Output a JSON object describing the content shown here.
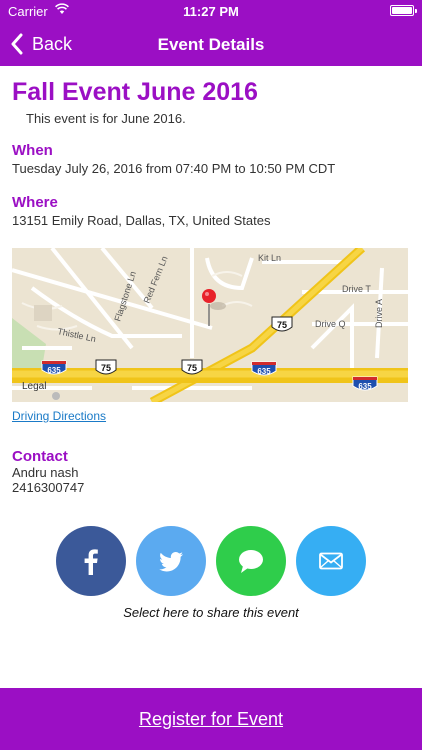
{
  "status": {
    "carrier": "Carrier",
    "time": "11:27 PM"
  },
  "nav": {
    "back_label": "Back",
    "title": "Event Details"
  },
  "event": {
    "title": "Fall Event June 2016",
    "description": "This event is for June 2016."
  },
  "when": {
    "label": "When",
    "text": "Tuesday July 26, 2016 from 07:40 PM to 10:50 PM CDT"
  },
  "where": {
    "label": "Where",
    "address": "13151 Emily Road, Dallas, TX, United States"
  },
  "map": {
    "legal": "Legal",
    "street_labels": [
      "Kit Ln",
      "Drive T",
      "Drive Q",
      "Drive A",
      "Flagstone Ln",
      "Red Fern Ln",
      "Thistle Ln"
    ],
    "highway_shields": [
      "75",
      "75",
      "75",
      "635",
      "635",
      "635"
    ]
  },
  "driving_directions": "Driving Directions",
  "contact": {
    "label": "Contact",
    "name": "Andru nash",
    "phone": "2416300747"
  },
  "share": {
    "caption": "Select here to share this event",
    "buttons": [
      {
        "name": "facebook",
        "icon": "facebook-icon",
        "color": "#3b5999"
      },
      {
        "name": "twitter",
        "icon": "twitter-icon",
        "color": "#5baaf0"
      },
      {
        "name": "message",
        "icon": "message-icon",
        "color": "#2fcd4b"
      },
      {
        "name": "email",
        "icon": "email-icon",
        "color": "#36aef3"
      }
    ]
  },
  "register_label": "Register for Event",
  "colors": {
    "accent": "#9b0fc4",
    "link": "#1a7ac7"
  }
}
